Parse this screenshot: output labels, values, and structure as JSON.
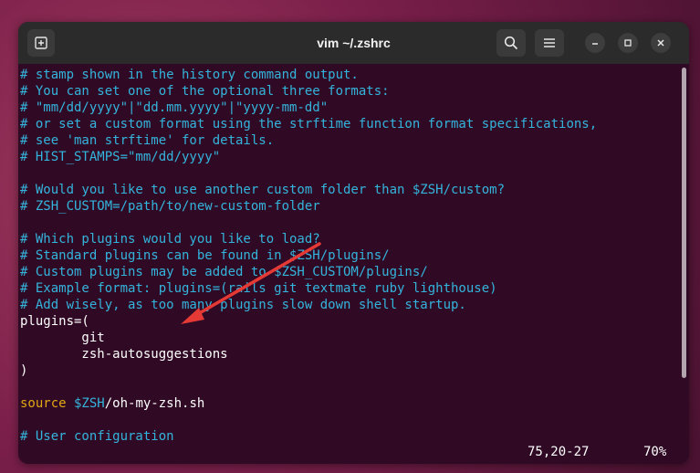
{
  "window": {
    "title": "vim ~/.zshrc"
  },
  "editor": {
    "lines": [
      {
        "cls": "comment",
        "text": "# stamp shown in the history command output."
      },
      {
        "cls": "comment",
        "text": "# You can set one of the optional three formats:"
      },
      {
        "cls": "comment",
        "text": "# \"mm/dd/yyyy\"|\"dd.mm.yyyy\"|\"yyyy-mm-dd\""
      },
      {
        "cls": "comment",
        "text": "# or set a custom format using the strftime function format specifications,"
      },
      {
        "cls": "comment",
        "text": "# see 'man strftime' for details."
      },
      {
        "cls": "comment",
        "text": "# HIST_STAMPS=\"mm/dd/yyyy\""
      },
      {
        "cls": "plain",
        "text": ""
      },
      {
        "cls": "comment",
        "text": "# Would you like to use another custom folder than $ZSH/custom?"
      },
      {
        "cls": "comment",
        "text": "# ZSH_CUSTOM=/path/to/new-custom-folder"
      },
      {
        "cls": "plain",
        "text": ""
      },
      {
        "cls": "comment",
        "text": "# Which plugins would you like to load?"
      },
      {
        "cls": "comment",
        "text": "# Standard plugins can be found in $ZSH/plugins/"
      },
      {
        "cls": "comment",
        "text": "# Custom plugins may be added to $ZSH_CUSTOM/plugins/"
      },
      {
        "cls": "comment",
        "text": "# Example format: plugins=(rails git textmate ruby lighthouse)"
      },
      {
        "cls": "comment",
        "text": "# Add wisely, as too many plugins slow down shell startup."
      },
      {
        "cls": "plain",
        "text": "plugins=("
      },
      {
        "cls": "plain",
        "text": "        git"
      },
      {
        "cls": "plain",
        "text": "        zsh-autosuggestions"
      },
      {
        "cls": "plain",
        "text": ")"
      },
      {
        "cls": "plain",
        "text": ""
      },
      {
        "cls": "source",
        "kw": "source",
        "var": " $ZSH",
        "rest": "/oh-my-zsh.sh"
      },
      {
        "cls": "plain",
        "text": ""
      },
      {
        "cls": "comment",
        "text": "# User configuration"
      }
    ]
  },
  "status": {
    "position": "75,20-27",
    "percent": "70%"
  },
  "icons": {
    "new_tab": "new-tab-icon",
    "search": "search-icon",
    "menu": "hamburger-menu-icon",
    "minimize": "minimize-icon",
    "maximize": "maximize-icon",
    "close": "close-icon"
  },
  "colors": {
    "terminal_bg": "#300a24",
    "comment": "#34b4dc",
    "keyword": "#e3a614",
    "annotation_arrow": "#e53935"
  }
}
